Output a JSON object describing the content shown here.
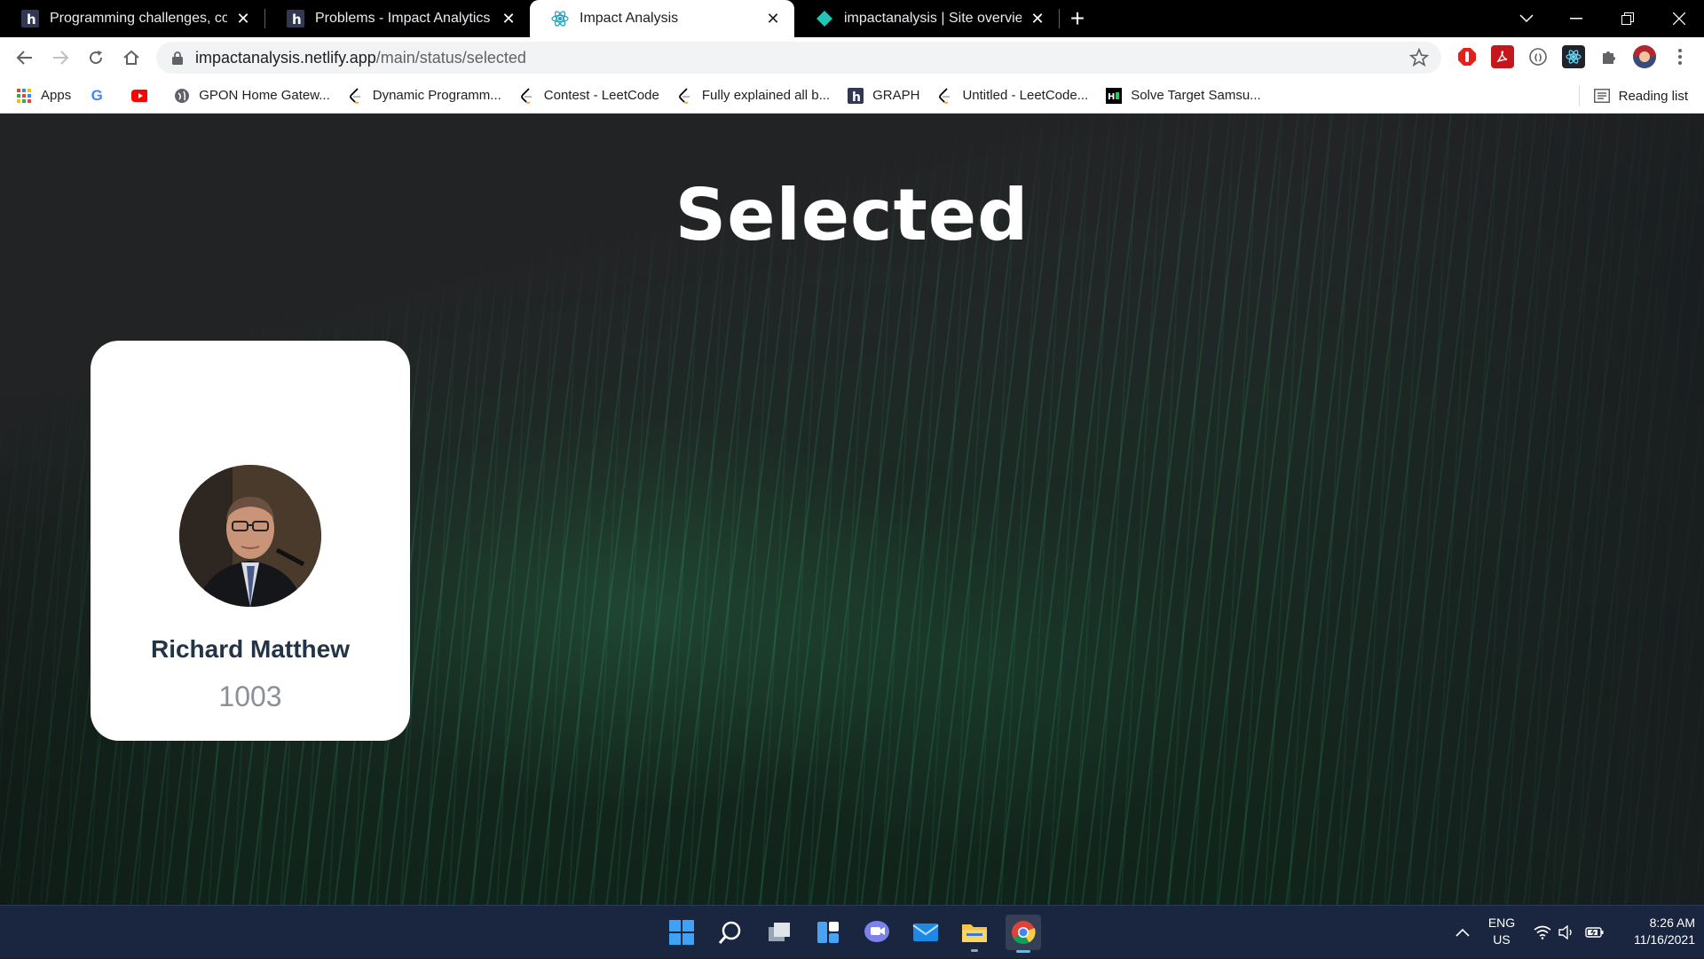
{
  "browser": {
    "tabs": [
      {
        "title": "Programming challenges, coding",
        "icon": "hackerearth-icon",
        "active": false
      },
      {
        "title": "Problems - Impact Analytics Soft",
        "icon": "hackerearth-icon",
        "active": false
      },
      {
        "title": "Impact Analysis",
        "icon": "react-icon",
        "active": true
      },
      {
        "title": "impactanalysis | Site overview",
        "icon": "netlify-icon",
        "active": false
      }
    ],
    "url_host": "impactanalysis.netlify.app",
    "url_path": "/main/status/selected"
  },
  "bookmarks": {
    "items": [
      {
        "label": "Apps",
        "icon": "apps-grid-icon"
      },
      {
        "label": "",
        "icon": "google-icon"
      },
      {
        "label": "",
        "icon": "youtube-icon"
      },
      {
        "label": "GPON Home Gatew...",
        "icon": "globe-icon"
      },
      {
        "label": "Dynamic Programm...",
        "icon": "leetcode-icon"
      },
      {
        "label": "Contest - LeetCode",
        "icon": "leetcode-icon"
      },
      {
        "label": "Fully explained all b...",
        "icon": "leetcode-icon"
      },
      {
        "label": "GRAPH",
        "icon": "hackerearth-icon"
      },
      {
        "label": "Untitled - LeetCode...",
        "icon": "leetcode-icon"
      },
      {
        "label": "Solve Target Samsu...",
        "icon": "hackerrank-icon"
      }
    ],
    "reading_list": "Reading list"
  },
  "page": {
    "heading": "Selected",
    "candidate": {
      "name": "Richard Matthew",
      "id": "1003"
    }
  },
  "taskbar": {
    "lang_line1": "ENG",
    "lang_line2": "US",
    "time": "8:26 AM",
    "date": "11/16/2021"
  },
  "colors": {
    "tab_strip": "#000000",
    "card": "#ffffff",
    "candidate_name": "#243447",
    "candidate_id": "#8a9099",
    "taskbar": "#1a2640"
  }
}
